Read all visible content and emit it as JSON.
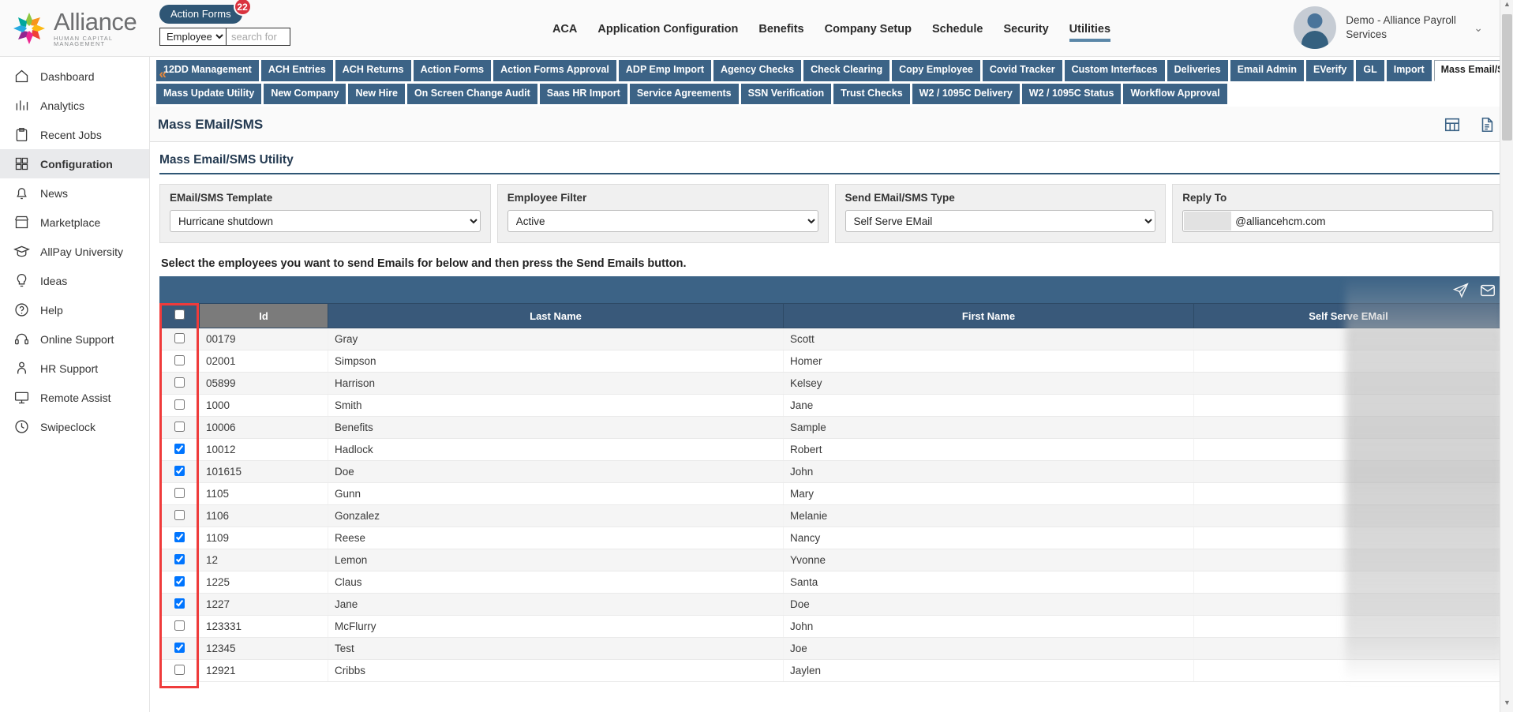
{
  "topbar": {
    "logo_name": "Alliance",
    "logo_tagline": "HUMAN CAPITAL MANAGEMENT",
    "action_forms_label": "Action Forms",
    "action_forms_badge": "22",
    "search_scope": "Employees",
    "search_placeholder": "search for",
    "search_value": "",
    "user_name": "Demo - Alliance Payroll Services",
    "nav": [
      {
        "label": "ACA",
        "active": false
      },
      {
        "label": "Application Configuration",
        "active": false
      },
      {
        "label": "Benefits",
        "active": false
      },
      {
        "label": "Company Setup",
        "active": false
      },
      {
        "label": "Schedule",
        "active": false
      },
      {
        "label": "Security",
        "active": false
      },
      {
        "label": "Utilities",
        "active": true
      }
    ]
  },
  "sidebar": {
    "collapse_label": "«",
    "items": [
      {
        "label": "Dashboard",
        "icon": "home-icon",
        "active": false
      },
      {
        "label": "Analytics",
        "icon": "analytics-icon",
        "active": false
      },
      {
        "label": "Recent Jobs",
        "icon": "clipboard-icon",
        "active": false
      },
      {
        "label": "Configuration",
        "icon": "grid-icon",
        "active": true
      },
      {
        "label": "News",
        "icon": "bell-icon",
        "active": false
      },
      {
        "label": "Marketplace",
        "icon": "store-icon",
        "active": false
      },
      {
        "label": "AllPay University",
        "icon": "graduation-icon",
        "active": false
      },
      {
        "label": "Ideas",
        "icon": "lightbulb-icon",
        "active": false
      },
      {
        "label": "Help",
        "icon": "question-icon",
        "active": false
      },
      {
        "label": "Online Support",
        "icon": "headset-icon",
        "active": false
      },
      {
        "label": "HR Support",
        "icon": "person-icon",
        "active": false
      },
      {
        "label": "Remote Assist",
        "icon": "monitor-icon",
        "active": false
      },
      {
        "label": "Swipeclock",
        "icon": "clock-icon",
        "active": false
      }
    ]
  },
  "subtabs": {
    "row1": [
      {
        "label": "12DD Management",
        "active": false
      },
      {
        "label": "ACH Entries",
        "active": false
      },
      {
        "label": "ACH Returns",
        "active": false
      },
      {
        "label": "Action Forms",
        "active": false
      },
      {
        "label": "Action Forms Approval",
        "active": false
      },
      {
        "label": "ADP Emp Import",
        "active": false
      },
      {
        "label": "Agency Checks",
        "active": false
      },
      {
        "label": "Check Clearing",
        "active": false
      },
      {
        "label": "Copy Employee",
        "active": false
      },
      {
        "label": "Covid Tracker",
        "active": false
      },
      {
        "label": "Custom Interfaces",
        "active": false
      },
      {
        "label": "Deliveries",
        "active": false
      },
      {
        "label": "Email Admin",
        "active": false
      },
      {
        "label": "EVerify",
        "active": false
      },
      {
        "label": "GL",
        "active": false
      },
      {
        "label": "Import",
        "active": false
      },
      {
        "label": "Mass Email/SMS",
        "active": true
      }
    ],
    "row2": [
      {
        "label": "Mass Update Utility",
        "active": false
      },
      {
        "label": "New Company",
        "active": false
      },
      {
        "label": "New Hire",
        "active": false
      },
      {
        "label": "On Screen Change Audit",
        "active": false
      },
      {
        "label": "Saas HR Import",
        "active": false
      },
      {
        "label": "Service Agreements",
        "active": false
      },
      {
        "label": "SSN Verification",
        "active": false
      },
      {
        "label": "Trust Checks",
        "active": false
      },
      {
        "label": "W2 / 1095C Delivery",
        "active": false
      },
      {
        "label": "W2 / 1095C Status",
        "active": false
      },
      {
        "label": "Workflow Approval",
        "active": false
      }
    ]
  },
  "page": {
    "title": "Mass EMail/SMS",
    "panel_heading": "Mass Email/SMS Utility",
    "instruction": "Select the employees you want to send Emails for below and then press the Send Emails button."
  },
  "filters": {
    "template_label": "EMail/SMS Template",
    "template_value": "Hurricane shutdown",
    "employee_filter_label": "Employee Filter",
    "employee_filter_value": "Active",
    "send_type_label": "Send EMail/SMS Type",
    "send_type_value": "Self Serve EMail",
    "reply_to_label": "Reply To",
    "reply_to_value": "@alliancehcm.com"
  },
  "grid": {
    "columns": [
      "",
      "Id",
      "Last Name",
      "First Name",
      "Self Serve EMail"
    ],
    "select_all_checked": false,
    "rows": [
      {
        "checked": false,
        "id": "00179",
        "last": "Gray",
        "first": "Scott",
        "email": ""
      },
      {
        "checked": false,
        "id": "02001",
        "last": "Simpson",
        "first": "Homer",
        "email": ""
      },
      {
        "checked": false,
        "id": "05899",
        "last": "Harrison",
        "first": "Kelsey",
        "email": ""
      },
      {
        "checked": false,
        "id": "1000",
        "last": "Smith",
        "first": "Jane",
        "email": ""
      },
      {
        "checked": false,
        "id": "10006",
        "last": "Benefits",
        "first": "Sample",
        "email": ""
      },
      {
        "checked": true,
        "id": "10012",
        "last": "Hadlock",
        "first": "Robert",
        "email": ""
      },
      {
        "checked": true,
        "id": "101615",
        "last": "Doe",
        "first": "John",
        "email": ""
      },
      {
        "checked": false,
        "id": "1105",
        "last": "Gunn",
        "first": "Mary",
        "email": ""
      },
      {
        "checked": false,
        "id": "1106",
        "last": "Gonzalez",
        "first": "Melanie",
        "email": ""
      },
      {
        "checked": true,
        "id": "1109",
        "last": "Reese",
        "first": "Nancy",
        "email": ""
      },
      {
        "checked": true,
        "id": "12",
        "last": "Lemon",
        "first": "Yvonne",
        "email": ""
      },
      {
        "checked": true,
        "id": "1225",
        "last": "Claus",
        "first": "Santa",
        "email": ""
      },
      {
        "checked": true,
        "id": "1227",
        "last": "Jane",
        "first": "Doe",
        "email": ""
      },
      {
        "checked": false,
        "id": "123331",
        "last": "McFlurry",
        "first": "John",
        "email": ""
      },
      {
        "checked": true,
        "id": "12345",
        "last": "Test",
        "first": "Joe",
        "email": ""
      },
      {
        "checked": false,
        "id": "12921",
        "last": "Cribbs",
        "first": "Jaylen",
        "email": ""
      }
    ]
  },
  "colors": {
    "nav_blue": "#3c6386",
    "header_blue": "#39597a",
    "accent_orange": "#e8883a",
    "badge_red": "#d9333f",
    "highlight_red": "#ef3b3b",
    "checkbox_blue": "#2a7de1"
  }
}
